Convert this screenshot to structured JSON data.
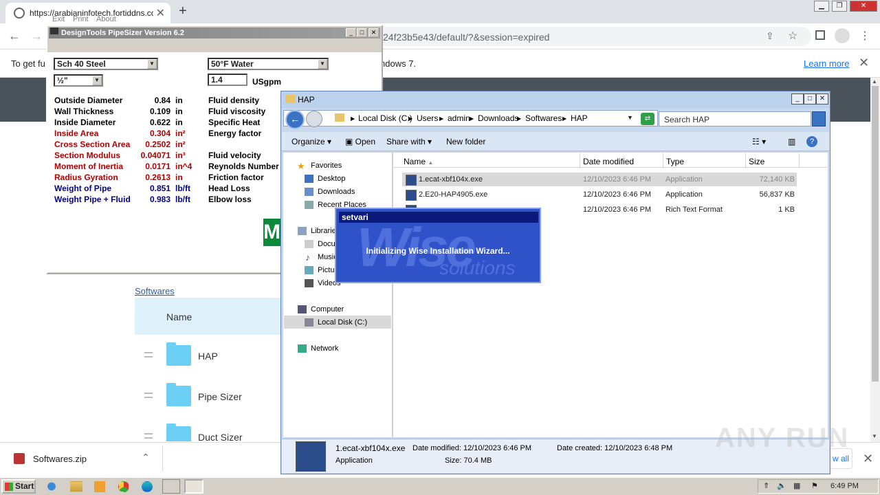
{
  "browser": {
    "tab_title": "https://arabianinfotech.fortiddns.co",
    "url": "24f23b5e43/default/?&session=expired",
    "infobar_text_left": "To get fu",
    "infobar_text_right": "ndows 7.",
    "learn_more": "Learn more"
  },
  "page": {
    "breadcrumb": "Softwares",
    "name_header": "Name",
    "folders": [
      "HAP",
      "Pipe Sizer",
      "Duct Sizer"
    ]
  },
  "downloads": {
    "file": "Softwares.zip",
    "show_all": "w all"
  },
  "pipesizer": {
    "title": "DesignTools PipeSizer Version 6.2",
    "menu": [
      "Exit",
      "Print",
      "About"
    ],
    "pipe_type": "Sch 40 Steel",
    "pipe_size": "½\"",
    "fluid": "50°F Water",
    "flow": "1.4",
    "flow_unit": "USgpm",
    "props": [
      {
        "label": "Outside Diameter",
        "value": "0.84",
        "unit": "in",
        "color": "blk"
      },
      {
        "label": "Wall Thickness",
        "value": "0.109",
        "unit": "in",
        "color": "blk"
      },
      {
        "label": "Inside Diameter",
        "value": "0.622",
        "unit": "in",
        "color": "blk"
      },
      {
        "label": "Inside Area",
        "value": "0.304",
        "unit": "in²",
        "color": "red"
      },
      {
        "label": "Cross Section Area",
        "value": "0.2502",
        "unit": "in²",
        "color": "red"
      },
      {
        "label": "Section Modulus",
        "value": "0.04071",
        "unit": "in³",
        "color": "red"
      },
      {
        "label": "Moment of Inertia",
        "value": "0.0171",
        "unit": "in^4",
        "color": "red"
      },
      {
        "label": "Radius Gyration",
        "value": "0.2613",
        "unit": "in",
        "color": "red"
      },
      {
        "label": "Weight of Pipe",
        "value": "0.851",
        "unit": "lb/ft",
        "color": "blu"
      },
      {
        "label": "Weight Pipe + Fluid",
        "value": "0.983",
        "unit": "lb/ft",
        "color": "blu"
      }
    ],
    "fluid_props": [
      "Fluid density",
      "Fluid viscosity",
      "Specific Heat",
      "Energy factor",
      "",
      "Fluid velocity",
      "Reynolds Number",
      "Friction factor",
      "Head Loss",
      "Elbow loss"
    ],
    "logo": "M"
  },
  "explorer": {
    "title": "HAP",
    "crumbs": [
      "Local Disk (C:)",
      "Users",
      "admin",
      "Downloads",
      "Softwares",
      "HAP"
    ],
    "search_placeholder": "Search HAP",
    "commands": [
      "Organize",
      "Open",
      "Share with",
      "New folder"
    ],
    "nav": {
      "favorites": "Favorites",
      "desktop": "Desktop",
      "downloads": "Downloads",
      "recent": "Recent Places",
      "libraries": "Librarie",
      "documents": "Docu",
      "music": "Music",
      "pictures": "Pictur",
      "videos": "Videos",
      "computer": "Computer",
      "localdisk": "Local Disk (C:)",
      "network": "Network"
    },
    "columns": [
      "Name",
      "Date modified",
      "Type",
      "Size"
    ],
    "files": [
      {
        "name": "1.ecat-xbf104x.exe",
        "date": "12/10/2023 6:46 PM",
        "type": "Application",
        "size": "72,140 KB"
      },
      {
        "name": "2.E20-HAP4905.exe",
        "date": "12/10/2023 6:46 PM",
        "type": "Application",
        "size": "56,837 KB"
      },
      {
        "name": "",
        "date": "12/10/2023 6:46 PM",
        "type": "Rich Text Format",
        "size": "1 KB"
      }
    ],
    "details": {
      "name": "1.ecat-xbf104x.exe",
      "type": "Application",
      "modified": "Date modified: 12/10/2023 6:46 PM",
      "size": "Size: 70.4 MB",
      "created": "Date created: 12/10/2023 6:48 PM"
    }
  },
  "wise_dialog": {
    "title": "setvari",
    "message": "Initializing Wise Installation Wizard...",
    "watermark": "Wise",
    "watermark2": "solutions"
  },
  "taskbar": {
    "start": "Start",
    "clock": "6:49 PM"
  },
  "watermark": "ANY RUN"
}
